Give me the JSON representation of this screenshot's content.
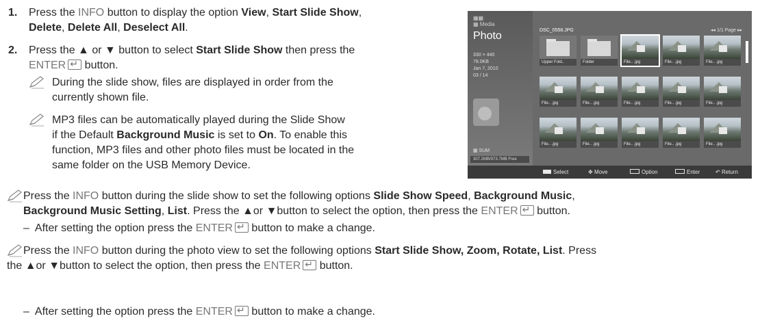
{
  "steps": [
    {
      "number": "1.",
      "parts": [
        "Press the ",
        "INFO",
        " button to display the option ",
        "View",
        ", ",
        "Start Slide Show",
        ",",
        "Delete",
        ", ",
        "Delete All",
        ", ",
        "Deselect All",
        "."
      ]
    },
    {
      "number": "2.",
      "parts": [
        "Press the ▲ or ▼ button to select ",
        "Start Slide Show",
        " then press the",
        "ENTER",
        " button."
      ]
    }
  ],
  "notes": {
    "note1": [
      "During the slide show, files are displayed in order from the",
      "currently shown file."
    ],
    "note2_lines": [
      [
        "MP3 files can be automatically played during the Slide Show"
      ],
      [
        "if the Default ",
        "Background Music",
        " is set to ",
        "On",
        ". To enable this"
      ],
      [
        "function, MP3 files and other photo files must be located in the"
      ],
      [
        "same folder on the USB Memory Device."
      ]
    ]
  },
  "tv": {
    "logo_line1": "▦▦",
    "logo_line2": "▦ Media",
    "section_title": "Photo",
    "meta": [
      "330 × 440",
      "78.0KB",
      "Jan 7, 2010",
      "03 / 14"
    ],
    "storage_label": "▦ SUM",
    "storage_free": "307.2MB/973.7MB Free",
    "file_name": "DSC_0558.JPG",
    "page_info": "◂◂  1/1 Page  ▸▸",
    "thumbs": [
      {
        "label": "Upper Fold..",
        "type": "folder"
      },
      {
        "label": "Folder",
        "type": "folder"
      },
      {
        "label": "File.. .jpg",
        "type": "photo",
        "selected": true
      },
      {
        "label": "File.. .jpg",
        "type": "photo"
      },
      {
        "label": "File.. .jpg",
        "type": "photo"
      },
      {
        "label": "File.. .jpg",
        "type": "photo"
      },
      {
        "label": "File.. .jpg",
        "type": "photo"
      },
      {
        "label": "File.. .jpg",
        "type": "photo"
      },
      {
        "label": "File.. .jpg",
        "type": "photo"
      },
      {
        "label": "File.. .jpg",
        "type": "photo"
      },
      {
        "label": "File.. .jpg",
        "type": "photo"
      },
      {
        "label": "File.. .jpg",
        "type": "photo"
      },
      {
        "label": "File.. .jpg",
        "type": "photo"
      },
      {
        "label": "File.. .jpg",
        "type": "photo"
      },
      {
        "label": "File.. .jpg",
        "type": "photo"
      }
    ],
    "footer": {
      "select": "Select",
      "move": "Move",
      "option": "Option",
      "enter": "Enter",
      "return": "Return"
    }
  },
  "bottom": {
    "note_a_line1": [
      "Press the ",
      "INFO",
      " button during the slide show to set the following options ",
      "Slide Show Speed",
      ", ",
      "Background Music",
      ","
    ],
    "note_a_line2": [
      "Background Music Setting",
      ", ",
      "List",
      ". Press the ▲or ▼button to select the option, then press the ",
      "ENTER",
      " button."
    ],
    "dash_a": [
      "After setting the option press the ",
      "ENTER",
      " button to make a change."
    ],
    "note_b_line1": [
      "Press the ",
      "INFO",
      " button during the photo view to set the following options ",
      "Start Slide Show, Zoom, Rotate, List",
      ". Press"
    ],
    "note_b_line2": [
      "the ▲or ▼button to select the option, then press the ",
      "ENTER",
      " button."
    ],
    "dash_b": [
      "After setting the option press the ",
      "ENTER",
      " button to make a change."
    ],
    "dash_symbol": "–"
  }
}
